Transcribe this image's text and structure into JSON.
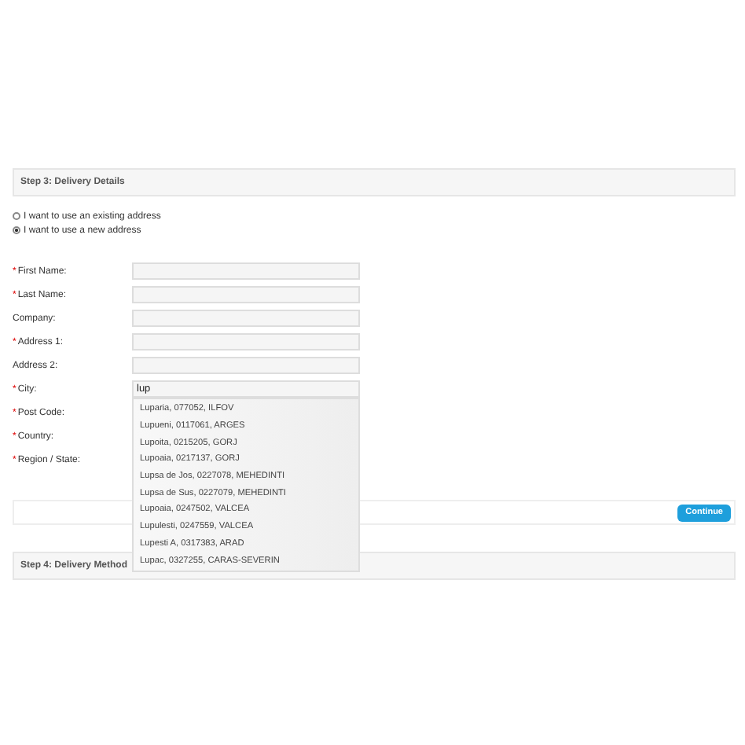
{
  "step3": {
    "title": "Step 3: Delivery Details"
  },
  "address_options": [
    {
      "label": "I want to use an existing address",
      "selected": false
    },
    {
      "label": "I want to use a new address",
      "selected": true
    }
  ],
  "fields": [
    {
      "mark": "*",
      "label": "First Name:"
    },
    {
      "mark": "*",
      "label": "Last Name:"
    },
    {
      "label": "Company:"
    },
    {
      "mark": "*",
      "label": "Address 1:"
    },
    {
      "label": "Address 2:"
    },
    {
      "mark": "*",
      "label": "City:",
      "value": "lup",
      "kind": "autocomplete"
    },
    {
      "mark": "*",
      "label": "Post Code:",
      "kind": "hidden"
    },
    {
      "mark": "*",
      "label": "Country:",
      "kind": "hidden"
    },
    {
      "mark": "*",
      "label": "Region / State:",
      "kind": "hidden"
    }
  ],
  "suggestions": [
    "Luparia, 077052, ILFOV",
    "Lupueni, 0117061, ARGES",
    "Lupoita, 0215205, GORJ",
    "Lupoaia, 0217137, GORJ",
    "Lupsa de Jos, 0227078, MEHEDINTI",
    "Lupsa de Sus, 0227079, MEHEDINTI",
    "Lupoaia, 0247502, VALCEA",
    "Lupulesti, 0247559, VALCEA",
    "Lupesti A, 0317383, ARAD",
    "Lupac, 0327255, CARAS-SEVERIN"
  ],
  "continue_button": "Continue",
  "step4": {
    "title": "Step 4: Delivery Method"
  }
}
